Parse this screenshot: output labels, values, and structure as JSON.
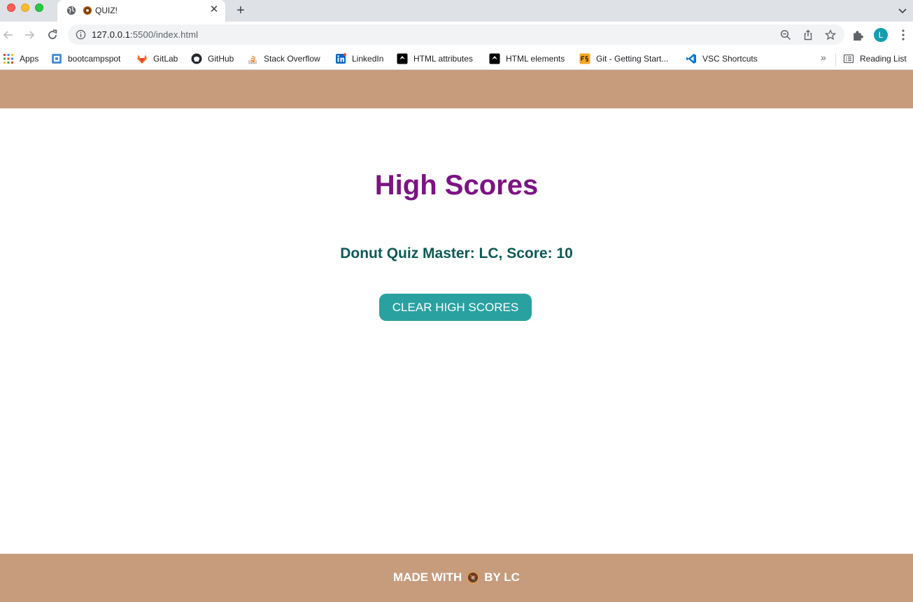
{
  "browser": {
    "tab": {
      "title": "QUIZ!"
    },
    "address": {
      "host": "127.0.0.1",
      "port_path": ":5500/index.html"
    },
    "profile_initial": "L",
    "bookmarks": [
      {
        "label": "Apps",
        "icon": "apps-grid-icon"
      },
      {
        "label": "bootcampspot",
        "icon": "bootcampspot-icon"
      },
      {
        "label": "GitLab",
        "icon": "gitlab-icon"
      },
      {
        "label": "GitHub",
        "icon": "github-icon"
      },
      {
        "label": "Stack Overflow",
        "icon": "stackoverflow-icon"
      },
      {
        "label": "LinkedIn",
        "icon": "linkedin-icon"
      },
      {
        "label": "HTML attributes",
        "icon": "html-attributes-icon"
      },
      {
        "label": "HTML elements",
        "icon": "html-elements-icon"
      },
      {
        "label": "Git - Getting Start...",
        "icon": "git-fs-icon"
      },
      {
        "label": "VSC Shortcuts",
        "icon": "vscode-icon"
      }
    ],
    "more_chevrons": "»",
    "reading_list": "Reading List"
  },
  "page": {
    "title": "High Scores",
    "score_line": "Donut Quiz Master: LC, Score: 10",
    "clear_button": "CLEAR HIGH SCORES",
    "footer_before": "MADE WITH",
    "footer_after": "BY LC"
  },
  "colors": {
    "header_footer": "#c69c7d",
    "title": "#7c1383",
    "score": "#0c5a57",
    "button": "#2aa1a1"
  }
}
